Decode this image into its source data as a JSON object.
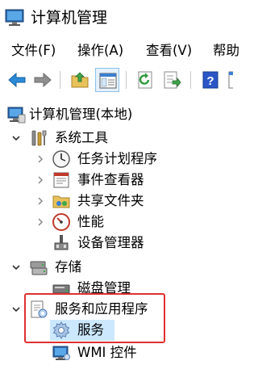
{
  "window": {
    "title": "计算机管理"
  },
  "menu": {
    "items": [
      "文件(F)",
      "操作(A)",
      "查看(V)",
      "帮助"
    ]
  },
  "toolbar": {
    "buttons": [
      "back-arrow-icon",
      "forward-arrow-icon",
      "up-folder-icon",
      "show-hide-tree-icon",
      "refresh-icon",
      "export-list-icon",
      "help-icon",
      "properties-icon"
    ]
  },
  "tree": {
    "root": "计算机管理(本地)",
    "system_tools": "系统工具",
    "task_scheduler": "任务计划程序",
    "event_viewer": "事件查看器",
    "shared_folders": "共享文件夹",
    "performance": "性能",
    "device_manager": "设备管理器",
    "storage": "存储",
    "disk_management": "磁盘管理",
    "services_apps": "服务和应用程序",
    "services": "服务",
    "wmi_control": "WMI 控件",
    "selected": "服务"
  },
  "colors": {
    "selection": "#cce8ff",
    "highlight_border": "#e03030",
    "accent_blue": "#1e6fd0"
  }
}
